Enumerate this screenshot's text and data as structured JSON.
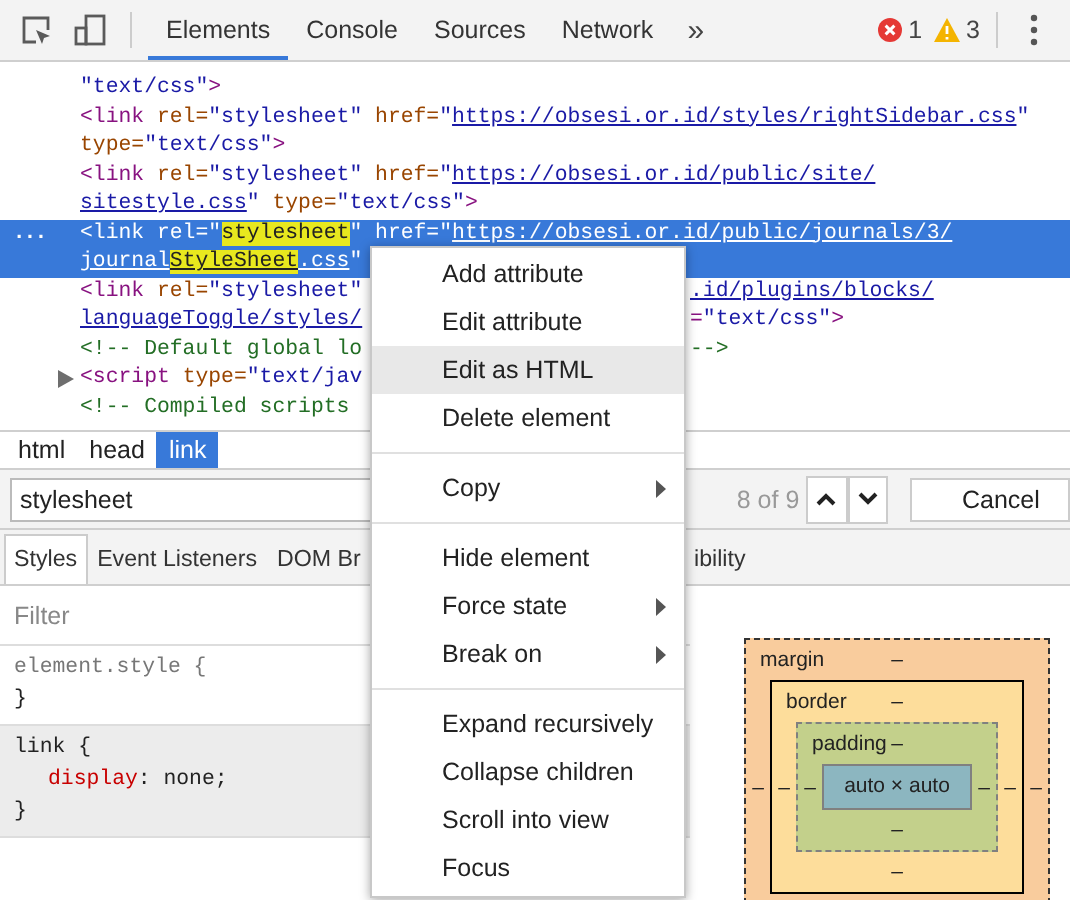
{
  "toolbar": {
    "tabs": [
      {
        "label": "Elements",
        "selected": true
      },
      {
        "label": "Console",
        "selected": false
      },
      {
        "label": "Sources",
        "selected": false
      },
      {
        "label": "Network",
        "selected": false
      }
    ],
    "more": "»",
    "errors": "1",
    "warnings": "3"
  },
  "dom_lines": [
    {
      "selected": false,
      "expandable": false,
      "left": [
        {
          "kind": "value",
          "text": "\"text/css\""
        },
        {
          "kind": "tag",
          "text": ">"
        }
      ]
    },
    {
      "selected": false,
      "expandable": false,
      "left": [
        {
          "kind": "tag",
          "text": "<link "
        },
        {
          "kind": "attr",
          "text": "rel="
        },
        {
          "kind": "value",
          "text": "\"stylesheet\" "
        },
        {
          "kind": "attr",
          "text": "href="
        },
        {
          "kind": "value",
          "text": "\""
        },
        {
          "kind": "url",
          "text": "https://obsesi.or.id/styles/rightSidebar.css"
        },
        {
          "kind": "value",
          "text": "\""
        }
      ]
    },
    {
      "selected": false,
      "expandable": false,
      "left": [
        {
          "kind": "attr",
          "text": "type="
        },
        {
          "kind": "value",
          "text": "\"text/css\""
        },
        {
          "kind": "tag",
          "text": ">"
        }
      ]
    },
    {
      "selected": false,
      "expandable": false,
      "left": [
        {
          "kind": "tag",
          "text": "<link "
        },
        {
          "kind": "attr",
          "text": "rel="
        },
        {
          "kind": "value",
          "text": "\"stylesheet\" "
        },
        {
          "kind": "attr",
          "text": "href="
        },
        {
          "kind": "value",
          "text": "\""
        },
        {
          "kind": "url",
          "text": "https://obsesi.or.id/public/site/"
        }
      ]
    },
    {
      "selected": false,
      "expandable": false,
      "left": [
        {
          "kind": "url",
          "text": "sitestyle.css"
        },
        {
          "kind": "value",
          "text": "\" "
        },
        {
          "kind": "attr",
          "text": "type="
        },
        {
          "kind": "value",
          "text": "\"text/css\""
        },
        {
          "kind": "tag",
          "text": ">"
        }
      ]
    },
    {
      "selected": true,
      "expandable": false,
      "gutter": "...",
      "left": [
        {
          "kind": "tag",
          "text": "<link "
        },
        {
          "kind": "attr",
          "text": "rel="
        },
        {
          "kind": "value",
          "text": "\""
        },
        {
          "kind": "match",
          "text": "stylesheet"
        },
        {
          "kind": "value",
          "text": "\" "
        },
        {
          "kind": "attr",
          "text": "href="
        },
        {
          "kind": "value",
          "text": "\""
        },
        {
          "kind": "url",
          "text": "https://obsesi.or.id/public/journals/3/"
        }
      ]
    },
    {
      "selected": true,
      "expandable": false,
      "left": [
        {
          "kind": "url",
          "text": "journal"
        },
        {
          "kind": "urlmatch",
          "text": "StyleSheet"
        },
        {
          "kind": "url",
          "text": ".css"
        },
        {
          "kind": "value",
          "text": "\""
        }
      ]
    },
    {
      "selected": false,
      "expandable": false,
      "left": [
        {
          "kind": "tag",
          "text": "<link "
        },
        {
          "kind": "attr",
          "text": "rel="
        },
        {
          "kind": "value",
          "text": "\"stylesheet\""
        }
      ],
      "right": [
        {
          "kind": "url",
          "text": ".id/plugins/blocks/"
        }
      ]
    },
    {
      "selected": false,
      "expandable": false,
      "left": [
        {
          "kind": "url",
          "text": "languageToggle/styles/"
        }
      ],
      "right": [
        {
          "kind": "tag",
          "text": "="
        },
        {
          "kind": "value",
          "text": "\"text/css\""
        },
        {
          "kind": "tag",
          "text": ">"
        }
      ]
    },
    {
      "selected": false,
      "expandable": false,
      "left": [
        {
          "kind": "comment",
          "text": "<!-- Default global lo"
        }
      ],
      "right": [
        {
          "kind": "comment",
          "text": "-->"
        }
      ]
    },
    {
      "selected": false,
      "expandable": true,
      "left": [
        {
          "kind": "tag",
          "text": "<script "
        },
        {
          "kind": "attr",
          "text": "type="
        },
        {
          "kind": "value",
          "text": "\"text/jav"
        }
      ]
    },
    {
      "selected": false,
      "expandable": false,
      "left": [
        {
          "kind": "comment",
          "text": "<!-- Compiled scripts"
        }
      ]
    }
  ],
  "breadcrumbs": [
    {
      "label": "html",
      "selected": false
    },
    {
      "label": "head",
      "selected": false
    },
    {
      "label": "link",
      "selected": true
    }
  ],
  "search": {
    "value": "stylesheet",
    "count": "8 of 9",
    "cancel": "Cancel"
  },
  "sidebar_tabs": [
    {
      "label": "Styles",
      "selected": true
    },
    {
      "label": "Event Listeners",
      "selected": false
    },
    {
      "label": "DOM Br",
      "selected": false
    }
  ],
  "sidebar_tab_fragment": "ibility",
  "styles": {
    "filter_placeholder": "Filter",
    "rules": [
      {
        "selector": "element.style {",
        "close": "}",
        "shaded": false
      },
      {
        "selector": "link {",
        "declarations": [
          {
            "property": "display",
            "rest": ": none;"
          }
        ],
        "close": "}",
        "shaded": true
      }
    ]
  },
  "box_model": {
    "margin": {
      "label": "margin",
      "top": "–",
      "left": "–",
      "right": "–"
    },
    "border": {
      "label": "border",
      "top": "–",
      "left": "–",
      "right": "–",
      "bottom": "–"
    },
    "padding": {
      "label": "padding",
      "top": "–",
      "left": "–",
      "right": "–",
      "bottom": "–"
    },
    "content": "auto × auto"
  },
  "context_menu": [
    {
      "kind": "item",
      "label": "Add attribute",
      "submenu": false,
      "highlighted": false
    },
    {
      "kind": "item",
      "label": "Edit attribute",
      "submenu": false,
      "highlighted": false
    },
    {
      "kind": "item",
      "label": "Edit as HTML",
      "submenu": false,
      "highlighted": true
    },
    {
      "kind": "item",
      "label": "Delete element",
      "submenu": false,
      "highlighted": false
    },
    {
      "kind": "separator"
    },
    {
      "kind": "item",
      "label": "Copy",
      "submenu": true,
      "highlighted": false
    },
    {
      "kind": "separator"
    },
    {
      "kind": "item",
      "label": "Hide element",
      "submenu": false,
      "highlighted": false
    },
    {
      "kind": "item",
      "label": "Force state",
      "submenu": true,
      "highlighted": false
    },
    {
      "kind": "item",
      "label": "Break on",
      "submenu": true,
      "highlighted": false
    },
    {
      "kind": "separator"
    },
    {
      "kind": "item",
      "label": "Expand recursively",
      "submenu": false,
      "highlighted": false
    },
    {
      "kind": "item",
      "label": "Collapse children",
      "submenu": false,
      "highlighted": false
    },
    {
      "kind": "item",
      "label": "Scroll into view",
      "submenu": false,
      "highlighted": false
    },
    {
      "kind": "item",
      "label": "Focus",
      "submenu": false,
      "highlighted": false
    }
  ]
}
